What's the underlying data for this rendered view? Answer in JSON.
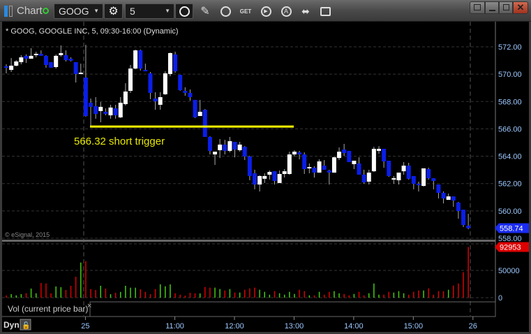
{
  "toolbar": {
    "title": "Chart",
    "symbol": "GOOG",
    "interval": "5"
  },
  "window": {
    "buttons": [
      "link",
      "minimize",
      "maximize",
      "close"
    ]
  },
  "chart_legend": "* GOOG, GOOGLE INC, 5, 09:30-16:00 (Dynamic)",
  "copyright": "© eSignal, 2015",
  "annotation": {
    "price": 566.32,
    "label": "566.32 short trigger",
    "color": "#ffff00"
  },
  "volume_legend": "Vol (current price bar)",
  "volume_close_glyph": "×",
  "dyn_label": "Dyn",
  "colors": {
    "up_candle": "#ffffff",
    "down_candle": "#0a1ee8",
    "up_volume": "#44cc11",
    "down_volume": "#dd0000",
    "last_price_badge": "#1a2cf0",
    "volume_badge": "#dd0000"
  },
  "chart_data": [
    {
      "type": "candlestick",
      "title": "GOOG, GOOGLE INC, 5, 09:30-16:00 (Dynamic)",
      "ylim": [
        558,
        573
      ],
      "y_ticks": [
        "572.00",
        "570.00",
        "568.00",
        "566.00",
        "564.00",
        "562.00",
        "560.00",
        "558.00"
      ],
      "y_tick_values": [
        572,
        570,
        568,
        566,
        564,
        562,
        560,
        558
      ],
      "x_ticks": [
        {
          "label": "25",
          "bar": 16
        },
        {
          "label": "11:00",
          "bar": 34
        },
        {
          "label": "12:00",
          "bar": 46
        },
        {
          "label": "13:00",
          "bar": 58
        },
        {
          "label": "14:00",
          "bar": 70
        },
        {
          "label": "15:00",
          "bar": 82
        },
        {
          "label": "26",
          "bar": 94
        }
      ],
      "last_price": "558.74",
      "ohlc": [
        [
          570.57,
          570.72,
          570.06,
          570.47
        ],
        [
          570.31,
          571.18,
          570.16,
          570.62
        ],
        [
          570.62,
          571.03,
          570.57,
          570.93
        ],
        [
          570.88,
          571.39,
          570.72,
          571.23
        ],
        [
          571.34,
          571.44,
          570.82,
          571.13
        ],
        [
          571.13,
          571.9,
          571.13,
          571.34
        ],
        [
          571.44,
          571.64,
          571.23,
          571.49
        ],
        [
          571.49,
          571.74,
          571.34,
          571.34
        ],
        [
          571.34,
          571.39,
          570.47,
          570.67
        ],
        [
          570.88,
          570.88,
          570.47,
          570.47
        ],
        [
          570.52,
          571.44,
          570.41,
          571.34
        ],
        [
          571.39,
          572.1,
          571.28,
          571.54
        ],
        [
          571.39,
          571.74,
          570.93,
          571.03
        ],
        [
          571.13,
          571.23,
          570.93,
          570.98
        ],
        [
          570.88,
          570.88,
          569.39,
          570.01
        ],
        [
          570.06,
          570.77,
          570.06,
          570.11
        ],
        [
          569.75,
          572.15,
          566.89,
          566.94
        ],
        [
          567.91,
          568.22,
          566.12,
          567.61
        ],
        [
          567.66,
          568.32,
          566.74,
          567.09
        ],
        [
          567.3,
          567.96,
          566.48,
          567.61
        ],
        [
          567.25,
          567.5,
          566.99,
          567.09
        ],
        [
          566.99,
          567.76,
          566.74,
          567.56
        ],
        [
          567.5,
          567.76,
          566.74,
          566.99
        ],
        [
          566.84,
          568.32,
          566.79,
          567.91
        ],
        [
          567.81,
          569.34,
          567.71,
          568.73
        ],
        [
          568.78,
          570.67,
          568.63,
          570.41
        ],
        [
          570.41,
          571.8,
          570.36,
          571.74
        ],
        [
          571.74,
          571.8,
          570.26,
          570.41
        ],
        [
          570.31,
          570.77,
          570.21,
          570.21
        ],
        [
          570.06,
          570.16,
          568.17,
          568.63
        ],
        [
          568.22,
          568.68,
          567.4,
          568.01
        ],
        [
          567.76,
          568.68,
          567.4,
          568.32
        ],
        [
          568.53,
          570.21,
          568.48,
          570.06
        ],
        [
          570.01,
          571.59,
          569.85,
          571.54
        ],
        [
          571.44,
          571.64,
          570.11,
          570.21
        ],
        [
          569.95,
          569.95,
          568.78,
          568.83
        ],
        [
          568.78,
          569.04,
          568.42,
          568.63
        ],
        [
          568.63,
          568.88,
          568.06,
          568.32
        ],
        [
          568.12,
          568.12,
          566.79,
          566.84
        ],
        [
          566.94,
          568.12,
          566.94,
          567.25
        ],
        [
          567.4,
          567.45,
          565.41,
          565.41
        ],
        [
          565.41,
          565.46,
          564.13,
          564.39
        ],
        [
          564.13,
          564.33,
          563.36,
          564.33
        ],
        [
          564.44,
          565.26,
          563.87,
          564.85
        ],
        [
          564.85,
          565.2,
          564.13,
          564.39
        ],
        [
          564.39,
          565.41,
          564.28,
          565.1
        ],
        [
          565.05,
          565.05,
          563.92,
          564.49
        ],
        [
          564.44,
          565.05,
          564.33,
          564.85
        ],
        [
          564.69,
          564.74,
          563.72,
          563.98
        ],
        [
          563.98,
          564.03,
          562.24,
          562.55
        ],
        [
          562.75,
          563.01,
          561.58,
          561.93
        ],
        [
          561.93,
          562.6,
          561.42,
          562.55
        ],
        [
          562.35,
          562.75,
          562.04,
          562.55
        ],
        [
          562.65,
          562.96,
          562.29,
          562.85
        ],
        [
          562.9,
          562.9,
          561.93,
          562.19
        ],
        [
          562.04,
          562.96,
          562.04,
          562.7
        ],
        [
          562.7,
          563.06,
          562.44,
          562.9
        ],
        [
          562.7,
          564.33,
          562.65,
          564.13
        ],
        [
          564.13,
          564.44,
          563.98,
          564.33
        ],
        [
          564.28,
          564.39,
          563.77,
          564.13
        ],
        [
          564.13,
          564.28,
          562.7,
          563.06
        ],
        [
          563.11,
          563.47,
          562.75,
          563.21
        ],
        [
          563.16,
          563.26,
          562.44,
          562.8
        ],
        [
          562.8,
          563.77,
          562.8,
          563.62
        ],
        [
          563.31,
          563.72,
          563.01,
          563.01
        ],
        [
          562.96,
          563.01,
          561.93,
          562.8
        ],
        [
          562.8,
          563.98,
          562.8,
          563.92
        ],
        [
          563.87,
          564.64,
          563.72,
          564.33
        ],
        [
          564.49,
          564.9,
          564.03,
          564.23
        ],
        [
          564.39,
          564.39,
          563.57,
          563.57
        ],
        [
          563.42,
          563.67,
          563.06,
          563.67
        ],
        [
          563.47,
          563.92,
          562.65,
          562.65
        ],
        [
          562.65,
          563.01,
          561.98,
          562.09
        ],
        [
          562.14,
          563.01,
          561.93,
          562.8
        ],
        [
          562.9,
          564.69,
          562.85,
          564.54
        ],
        [
          564.39,
          564.74,
          564.18,
          564.54
        ],
        [
          564.54,
          564.54,
          563.16,
          563.62
        ],
        [
          563.67,
          563.67,
          562.49,
          562.55
        ],
        [
          562.29,
          562.55,
          561.98,
          562.39
        ],
        [
          562.24,
          562.8,
          561.93,
          562.8
        ],
        [
          562.9,
          563.57,
          562.65,
          563.31
        ],
        [
          563.31,
          563.52,
          562.29,
          562.35
        ],
        [
          562.55,
          562.55,
          561.58,
          561.98
        ],
        [
          561.98,
          562.14,
          561.42,
          561.88
        ],
        [
          561.83,
          563.11,
          561.78,
          563.11
        ],
        [
          563.06,
          563.16,
          562.29,
          562.39
        ],
        [
          562.39,
          562.39,
          561.58,
          562.19
        ],
        [
          561.93,
          561.93,
          560.91,
          561.32
        ],
        [
          561.32,
          561.42,
          560.55,
          560.91
        ],
        [
          560.81,
          561.27,
          560.81,
          561.06
        ],
        [
          561.06,
          561.06,
          560.3,
          560.76
        ],
        [
          560.61,
          560.66,
          559.43,
          559.99
        ],
        [
          560.09,
          560.09,
          558.82,
          558.97
        ],
        [
          558.92,
          559.79,
          558.66,
          558.74
        ]
      ]
    },
    {
      "type": "bar",
      "title": "Vol (current price bar)",
      "ylim": [
        0,
        95000
      ],
      "y_ticks": [
        "50000",
        "0"
      ],
      "y_tick_values": [
        50000,
        0
      ],
      "last_value": "92953",
      "values": [
        4200,
        6400,
        4200,
        6400,
        8100,
        16700,
        8100,
        26900,
        26000,
        8100,
        20500,
        19200,
        14100,
        21800,
        38500,
        64500,
        66700,
        15800,
        14100,
        21800,
        16700,
        6400,
        9000,
        10600,
        21800,
        18300,
        18300,
        15400,
        10600,
        6400,
        15800,
        24400,
        20900,
        24400,
        8100,
        5500,
        3800,
        9000,
        8100,
        7700,
        19600,
        18400,
        18400,
        15800,
        13200,
        15800,
        9400,
        9400,
        14500,
        17100,
        18400,
        14500,
        10700,
        5500,
        12000,
        8100,
        5500,
        10700,
        6800,
        14500,
        12000,
        4300,
        4300,
        10700,
        5500,
        10700,
        12000,
        8100,
        6800,
        4300,
        6800,
        10700,
        4300,
        8100,
        26000,
        5500,
        5500,
        10700,
        9400,
        12000,
        8100,
        5500,
        10700,
        13200,
        13200,
        17100,
        5500,
        12000,
        12000,
        14500,
        22200,
        26000,
        46600,
        92953
      ]
    }
  ]
}
